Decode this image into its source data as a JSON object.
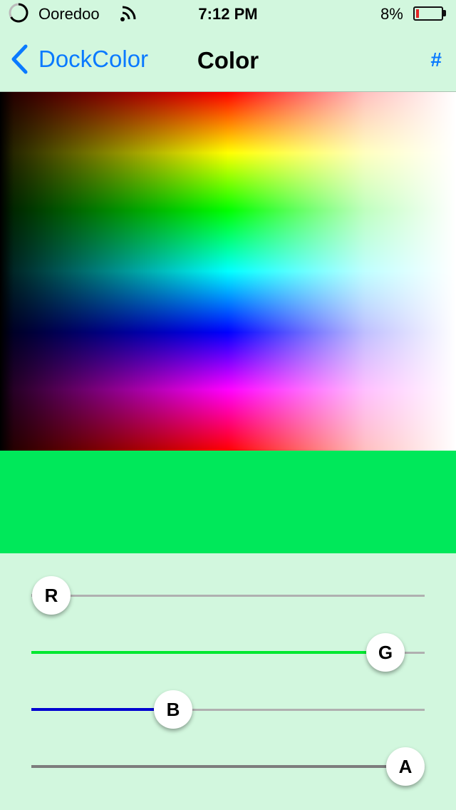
{
  "status_bar": {
    "carrier": "Ooredoo",
    "time": "7:12 PM",
    "battery_percent_text": "8%",
    "battery_level": 0.08,
    "icons": [
      "carrier-activity-icon",
      "wifi-icon",
      "battery-icon"
    ]
  },
  "nav": {
    "back_label": "DockColor",
    "title": "Color",
    "hex_button_label": "#"
  },
  "picker": {
    "selected_color": "#00e85a"
  },
  "sliders": [
    {
      "name": "red",
      "label": "R",
      "value": 0.05,
      "color": "#b0b0b0"
    },
    {
      "name": "green",
      "label": "G",
      "value": 0.9,
      "color": "#00e830"
    },
    {
      "name": "blue",
      "label": "B",
      "value": 0.36,
      "color": "#0000d0"
    },
    {
      "name": "alpha",
      "label": "A",
      "value": 1.0,
      "color": "#7d7d7d"
    }
  ],
  "colors": {
    "accent": "#0a7aff",
    "background": "#d2f7de",
    "battery_low": "#e32525"
  }
}
